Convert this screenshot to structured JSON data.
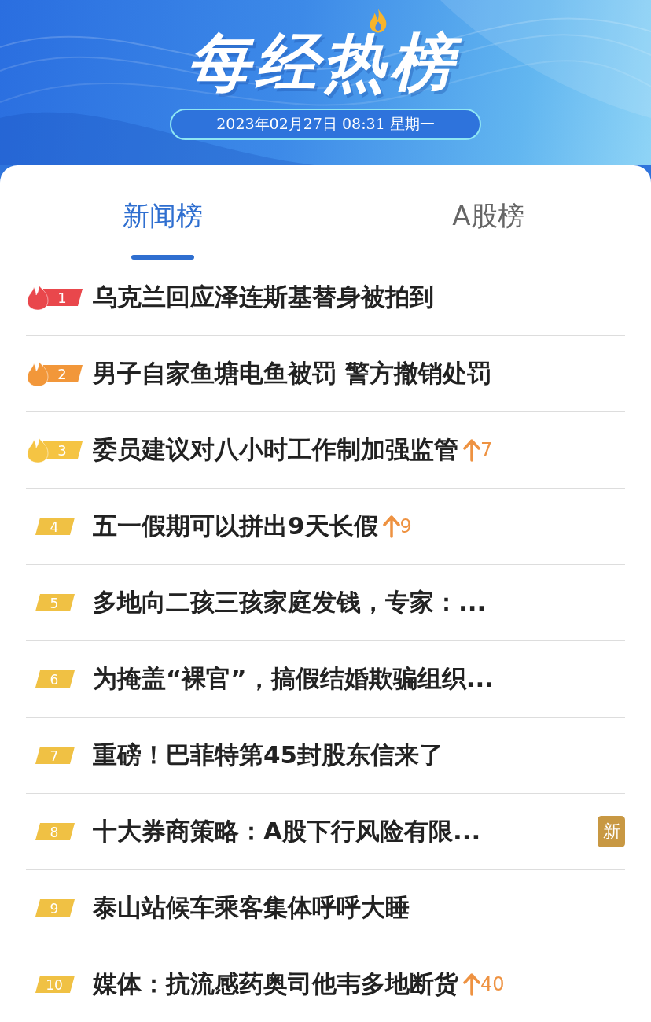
{
  "header": {
    "title": "每经热榜",
    "date": "2023年02月27日 08:31 星期一"
  },
  "tabs": [
    {
      "label": "新闻榜",
      "selected": true
    },
    {
      "label": "A股榜",
      "selected": false
    }
  ],
  "items": [
    {
      "rank": "1",
      "kind": "flame",
      "color": "#e9474c",
      "title": "乌克兰回应泽连斯基替身被拍到"
    },
    {
      "rank": "2",
      "kind": "flame",
      "color": "#f2973a",
      "title": "男子自家鱼塘电鱼被罚 警方撤销处罚"
    },
    {
      "rank": "3",
      "kind": "flame",
      "color": "#f5c443",
      "title": "委员建议对八小时工作制加强监管",
      "rise": "7"
    },
    {
      "rank": "4",
      "kind": "plain",
      "color": "#f0c144",
      "title": "五一假期可以拼出9天长假",
      "rise": "9"
    },
    {
      "rank": "5",
      "kind": "plain",
      "color": "#f0c144",
      "title": "多地向二孩三孩家庭发钱，专家：..."
    },
    {
      "rank": "6",
      "kind": "plain",
      "color": "#f0c144",
      "title": "为掩盖“裸官”，搞假结婚欺骗组织..."
    },
    {
      "rank": "7",
      "kind": "plain",
      "color": "#f0c144",
      "title": "重磅！巴菲特第45封股东信来了"
    },
    {
      "rank": "8",
      "kind": "plain",
      "color": "#f0c144",
      "title": "十大券商策略：A股下行风险有限...",
      "tag": "新"
    },
    {
      "rank": "9",
      "kind": "plain",
      "color": "#f0c144",
      "title": "泰山站候车乘客集体呼呼大睡"
    },
    {
      "rank": "10",
      "kind": "plain",
      "color": "#f0c144",
      "title": "媒体：抗流感药奥司他韦多地断货",
      "rise": "40"
    }
  ]
}
